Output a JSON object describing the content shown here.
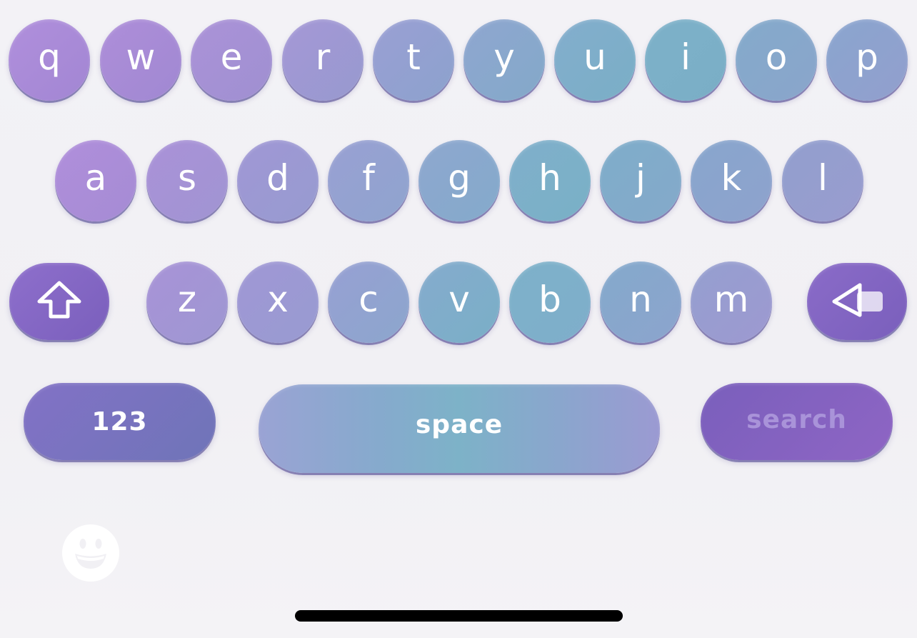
{
  "keyboard": {
    "row1": [
      "q",
      "w",
      "e",
      "r",
      "t",
      "y",
      "u",
      "i",
      "o",
      "p"
    ],
    "row2": [
      "a",
      "s",
      "d",
      "f",
      "g",
      "h",
      "j",
      "k",
      "l"
    ],
    "row3": [
      "z",
      "x",
      "c",
      "v",
      "b",
      "n",
      "m"
    ],
    "shift_icon": "shift-arrow-icon",
    "delete_icon": "backspace-icon",
    "numbers_label": "123",
    "space_label": "space",
    "search_label": "search",
    "emoji_icon": "grinning-face-icon"
  },
  "colors": {
    "purple_light": "#a98ad8",
    "lavender": "#9d98d4",
    "slate_blue": "#8d9ed0",
    "teal_blue": "#7cb0c9",
    "dark_purple": "#7e62bd",
    "search_text": "#a993d9",
    "home_indicator": "#000000"
  }
}
